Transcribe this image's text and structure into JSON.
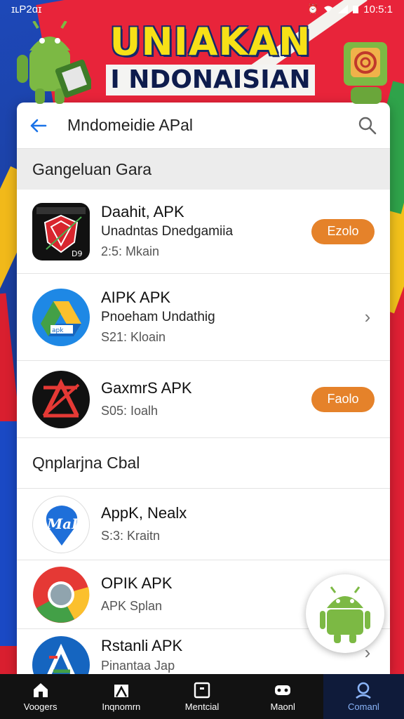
{
  "status_bar": {
    "left_text": "ɪʟP2ɑɪ",
    "time": "10:5:1"
  },
  "banner": {
    "line1": "UNIAKAN",
    "line2": "I NDONAISIAN"
  },
  "search": {
    "query": "Mndomeidie APal"
  },
  "sections": {
    "first_title": "Gangeluan Gara",
    "second_title": "Qnplarjna Cbal"
  },
  "apps_section1": [
    {
      "title": "Daahit, APK",
      "subtitle": "Unadntas Dnedgamiia",
      "meta": "2:5: Mkain",
      "action": "button",
      "button_label": "Ezolo",
      "icon": "shield-icon"
    },
    {
      "title": "AIPK APK",
      "subtitle": "Pnoeham Undathig",
      "meta": "S21: Kloain",
      "action": "chevron",
      "icon": "drive-like-icon"
    },
    {
      "title": "GaxmrS APK",
      "subtitle": "",
      "meta": "S05: Ioalh",
      "action": "button",
      "button_label": "Faolo",
      "icon": "red-a-icon"
    }
  ],
  "apps_section2": [
    {
      "title": "AppK, Nealx",
      "meta": "S:3: Kraitn",
      "action": "none",
      "icon": "map-pin-icon"
    },
    {
      "title": "OPIK APK",
      "meta": "APK Splan",
      "action": "chevron",
      "icon": "chrome-like-icon"
    },
    {
      "title": "Rstanli APK",
      "meta": "Pinantaa Jap",
      "action": "chevron",
      "icon": "blue-a-icon"
    }
  ],
  "bottom_nav": [
    {
      "label": "Voogers",
      "icon": "home-icon",
      "active": false
    },
    {
      "label": "Inqnomrn",
      "icon": "store-icon",
      "active": false
    },
    {
      "label": "Mentcial",
      "icon": "square-icon",
      "active": false
    },
    {
      "label": "Maonl",
      "icon": "gamepad-icon",
      "active": false
    },
    {
      "label": "Comanl",
      "icon": "search-icon",
      "active": true
    }
  ],
  "colors": {
    "accent_button": "#e5822a",
    "link_blue": "#1a73e8",
    "banner_yellow": "#f7e117"
  }
}
